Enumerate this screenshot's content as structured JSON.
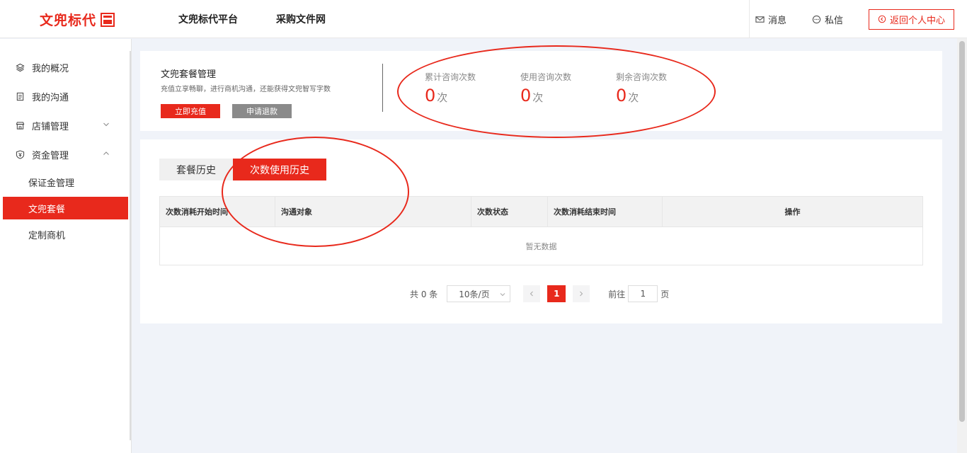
{
  "header": {
    "logo_text": "文兜标代",
    "nav": [
      "文兜标代平台",
      "采购文件网"
    ],
    "messages_label": "消息",
    "private_msg_label": "私信",
    "back_label": "返回个人中心"
  },
  "sidebar": {
    "items": [
      {
        "label": "我的概况",
        "icon": "layers-icon"
      },
      {
        "label": "我的沟通",
        "icon": "document-icon"
      },
      {
        "label": "店铺管理",
        "icon": "store-icon"
      },
      {
        "label": "资金管理",
        "icon": "shield-yen-icon"
      }
    ],
    "subitems": [
      "保证金管理",
      "文兜套餐",
      "定制商机"
    ],
    "active_subitem": "文兜套餐"
  },
  "package": {
    "title": "文兜套餐管理",
    "description": "充值立享畅聊，进行商机沟通，还能获得文兜智写字数",
    "recharge_label": "立即充值",
    "refund_label": "申请退款",
    "stats": [
      {
        "label": "累计咨询次数",
        "value": "0",
        "unit": "次"
      },
      {
        "label": "使用咨询次数",
        "value": "0",
        "unit": "次"
      },
      {
        "label": "剩余咨询次数",
        "value": "0",
        "unit": "次"
      }
    ]
  },
  "history": {
    "tabs": [
      "套餐历史",
      "次数使用历史"
    ],
    "active_tab": "次数使用历史",
    "columns": [
      "次数消耗开始时间",
      "沟通对象",
      "次数状态",
      "次数消耗结束时间",
      "操作"
    ],
    "empty_text": "暂无数据"
  },
  "pagination": {
    "total_text": "共 0 条",
    "page_size": "10条/页",
    "current_page": "1",
    "goto_label": "前往",
    "goto_value": "1",
    "page_suffix": "页"
  },
  "colors": {
    "accent": "#e8291c",
    "annotation": "#e8291c"
  }
}
